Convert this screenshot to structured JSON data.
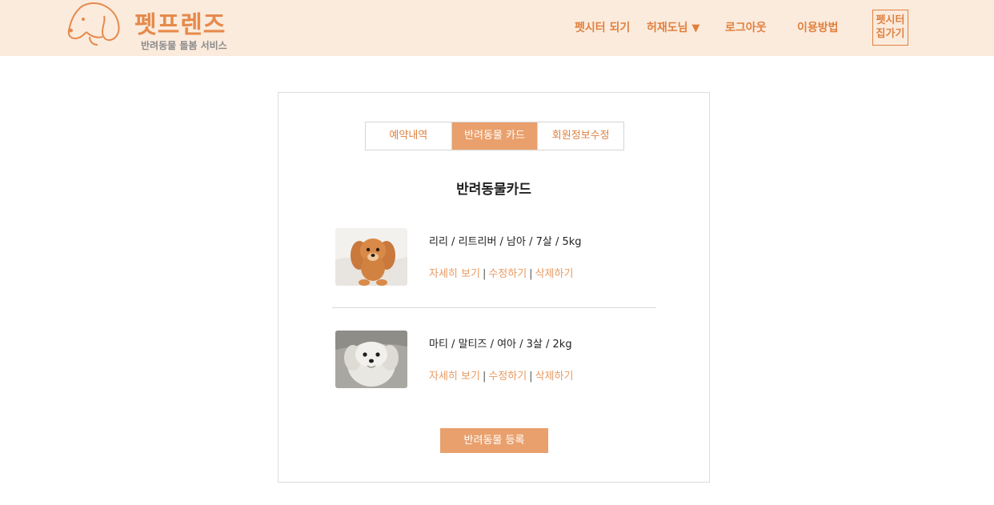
{
  "header": {
    "logo_title": "펫프렌즈",
    "logo_subtitle": "반려동물 돌봄 서비스",
    "nav": {
      "petsitter": "펫시터 되기",
      "user": "허재도님",
      "logout": "로그아웃",
      "howto": "이용방법",
      "go_home_line1": "펫시터",
      "go_home_line2": "집가기"
    }
  },
  "tabs": [
    {
      "label": "예약내역",
      "active": false
    },
    {
      "label": "반려동물 카드",
      "active": true
    },
    {
      "label": "회원정보수정",
      "active": false
    }
  ],
  "card_title": "반려동물카드",
  "pets": [
    {
      "info": "리리 / 리트리버 / 남아 / 7살 / 5kg",
      "photo": "puppy-retriever-photo",
      "detail": "자세히 보기",
      "edit": "수정하기",
      "delete": "삭제하기"
    },
    {
      "info": "마티 / 말티즈 / 여아 / 3살 / 2kg",
      "photo": "maltese-photo",
      "detail": "자세히 보기",
      "edit": "수정하기",
      "delete": "삭제하기"
    }
  ],
  "separator": "|",
  "register_button": "반려동물 등록",
  "colors": {
    "header_bg": "#fbebdd",
    "accent": "#e0813f",
    "button": "#e9a06d"
  }
}
